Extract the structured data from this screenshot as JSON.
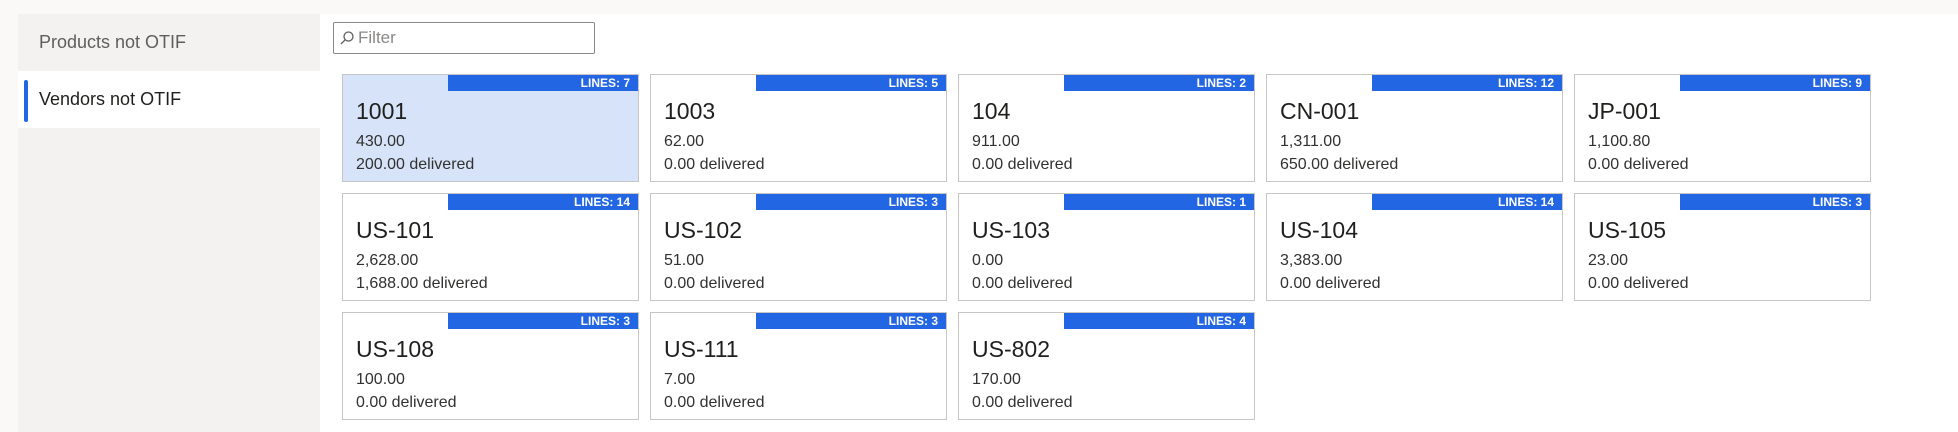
{
  "sidebar": {
    "items": [
      {
        "label": "Products not OTIF"
      },
      {
        "label": "Vendors not OTIF"
      }
    ]
  },
  "filter": {
    "placeholder": "Filter",
    "value": ""
  },
  "tiles": [
    {
      "name": "1001",
      "amount": "430.00",
      "delivered": "200.00 delivered",
      "lines": "LINES: 7"
    },
    {
      "name": "1003",
      "amount": "62.00",
      "delivered": "0.00 delivered",
      "lines": "LINES: 5"
    },
    {
      "name": "104",
      "amount": "911.00",
      "delivered": "0.00 delivered",
      "lines": "LINES: 2"
    },
    {
      "name": "CN-001",
      "amount": "1,311.00",
      "delivered": "650.00 delivered",
      "lines": "LINES: 12"
    },
    {
      "name": "JP-001",
      "amount": "1,100.80",
      "delivered": "0.00 delivered",
      "lines": "LINES: 9"
    },
    {
      "name": "US-101",
      "amount": "2,628.00",
      "delivered": "1,688.00 delivered",
      "lines": "LINES: 14"
    },
    {
      "name": "US-102",
      "amount": "51.00",
      "delivered": "0.00 delivered",
      "lines": "LINES: 3"
    },
    {
      "name": "US-103",
      "amount": "0.00",
      "delivered": "0.00 delivered",
      "lines": "LINES: 1"
    },
    {
      "name": "US-104",
      "amount": "3,383.00",
      "delivered": "0.00 delivered",
      "lines": "LINES: 14"
    },
    {
      "name": "US-105",
      "amount": "23.00",
      "delivered": "0.00 delivered",
      "lines": "LINES: 3"
    },
    {
      "name": "US-108",
      "amount": "100.00",
      "delivered": "0.00 delivered",
      "lines": "LINES: 3"
    },
    {
      "name": "US-111",
      "amount": "7.00",
      "delivered": "0.00 delivered",
      "lines": "LINES: 3"
    },
    {
      "name": "US-802",
      "amount": "170.00",
      "delivered": "0.00 delivered",
      "lines": "LINES: 4"
    }
  ],
  "colors": {
    "accent": "#2266e3",
    "selected_tile": "#d6e3f8"
  },
  "icons": {
    "filter": "search-icon"
  }
}
